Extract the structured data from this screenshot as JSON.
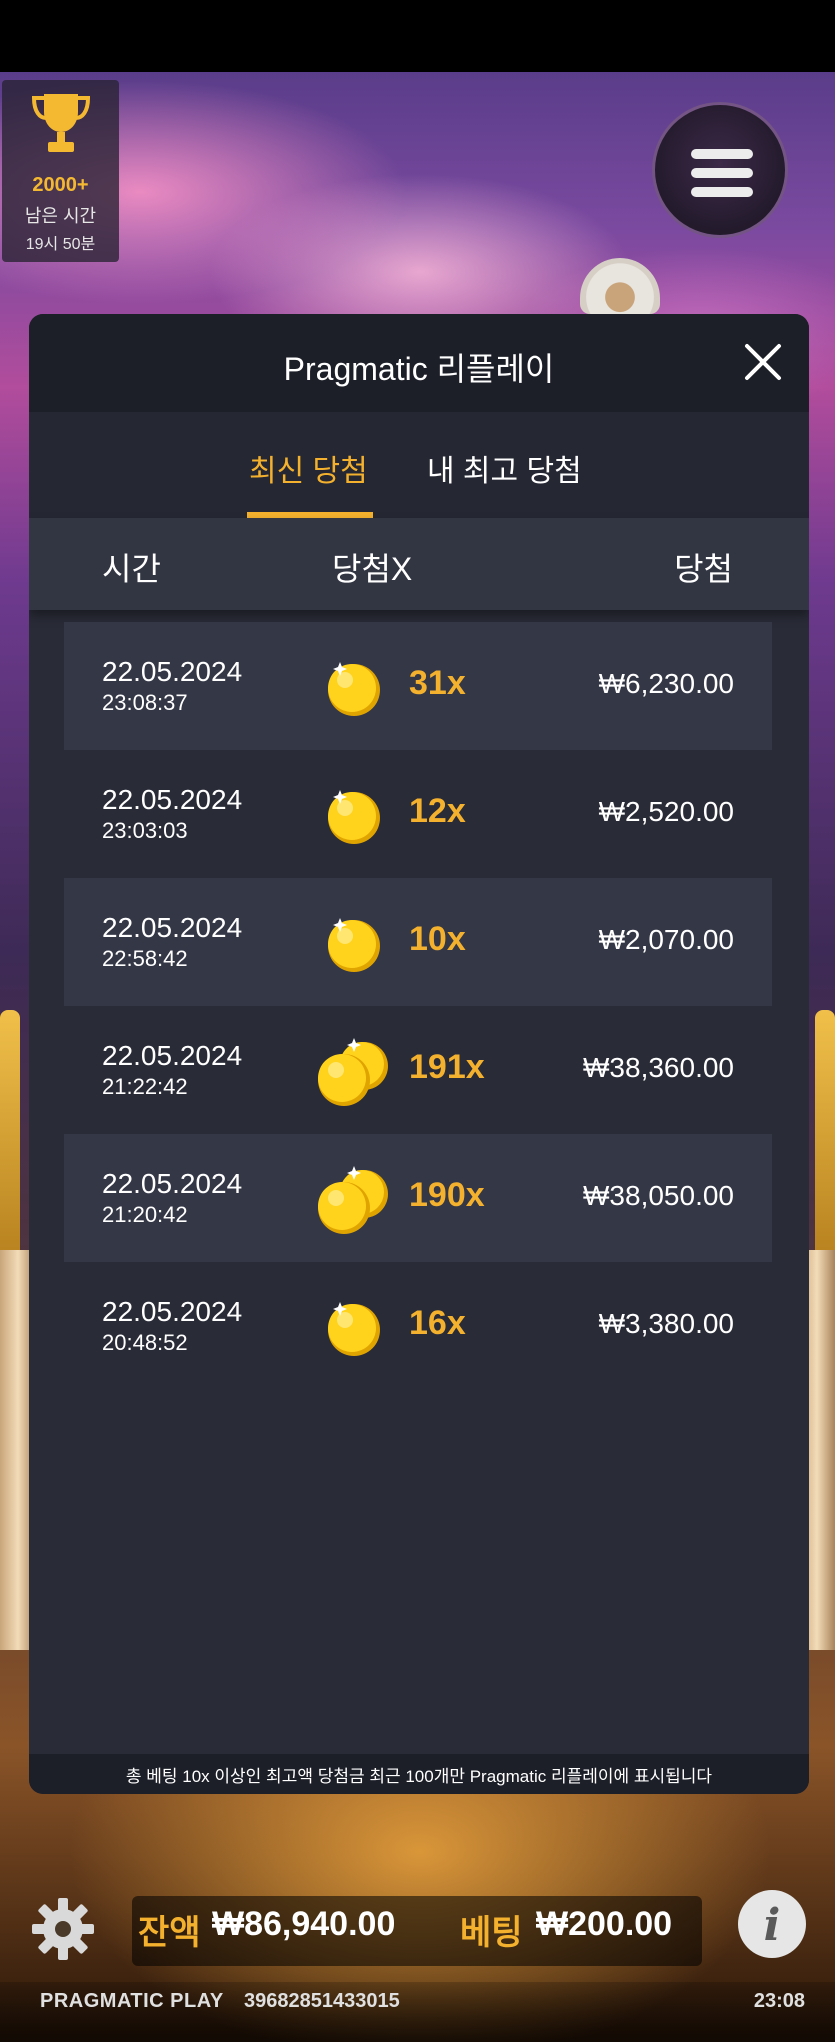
{
  "trophy": {
    "count": "2000+",
    "label": "남은 시간",
    "time": "19시 50분"
  },
  "modal": {
    "title": "Pragmatic 리플레이",
    "tabs": [
      {
        "label": "최신 당첨",
        "active": true
      },
      {
        "label": "내 최고 당첨",
        "active": false
      }
    ],
    "columns": {
      "time": "시간",
      "multiplier": "당첨X",
      "win": "당첨"
    },
    "rows": [
      {
        "date": "22.05.2024",
        "time": "23:08:37",
        "multiplier": "31x",
        "amount": "₩6,230.00",
        "coins": "single-coin-icon"
      },
      {
        "date": "22.05.2024",
        "time": "23:03:03",
        "multiplier": "12x",
        "amount": "₩2,520.00",
        "coins": "single-coin-icon"
      },
      {
        "date": "22.05.2024",
        "time": "22:58:42",
        "multiplier": "10x",
        "amount": "₩2,070.00",
        "coins": "single-coin-icon"
      },
      {
        "date": "22.05.2024",
        "time": "21:22:42",
        "multiplier": "191x",
        "amount": "₩38,360.00",
        "coins": "double-coin-icon"
      },
      {
        "date": "22.05.2024",
        "time": "21:20:42",
        "multiplier": "190x",
        "amount": "₩38,050.00",
        "coins": "double-coin-icon"
      },
      {
        "date": "22.05.2024",
        "time": "20:48:52",
        "multiplier": "16x",
        "amount": "₩3,380.00",
        "coins": "single-coin-icon"
      }
    ],
    "footer_note": "총 베팅 10x 이상인 최고액 당첨금 최근 100개만 Pragmatic 리플레이에 표시됩니다"
  },
  "bottom": {
    "balance_label": "잔액",
    "balance_value": "₩86,940.00",
    "bet_label": "베팅",
    "bet_value": "₩200.00"
  },
  "status": {
    "brand": "PRAGMATIC PLAY",
    "session_id": "39682851433015",
    "clock": "23:08"
  },
  "colors": {
    "accent": "#f4b12e",
    "modal_bg": "#292b37",
    "row_shade": "#343746"
  },
  "icons": {
    "trophy": "trophy-icon",
    "menu": "hamburger-menu-icon",
    "close": "close-icon",
    "settings": "gear-icon",
    "info": "info-icon"
  }
}
